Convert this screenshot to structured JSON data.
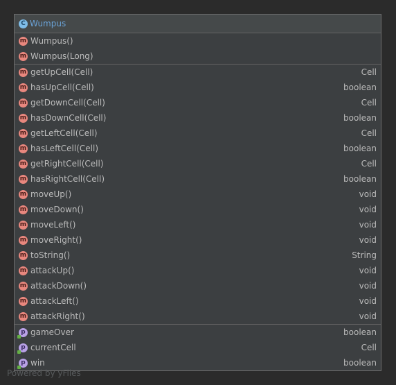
{
  "class": {
    "name": "Wumpus",
    "icon": "class-icon",
    "icon_letter": "C"
  },
  "constructors": [
    {
      "name": "Wumpus()",
      "type": ""
    },
    {
      "name": "Wumpus(Long)",
      "type": ""
    }
  ],
  "methods": [
    {
      "name": "getUpCell(Cell)",
      "type": "Cell"
    },
    {
      "name": "hasUpCell(Cell)",
      "type": "boolean"
    },
    {
      "name": "getDownCell(Cell)",
      "type": "Cell"
    },
    {
      "name": "hasDownCell(Cell)",
      "type": "boolean"
    },
    {
      "name": "getLeftCell(Cell)",
      "type": "Cell"
    },
    {
      "name": "hasLeftCell(Cell)",
      "type": "boolean"
    },
    {
      "name": "getRightCell(Cell)",
      "type": "Cell"
    },
    {
      "name": "hasRightCell(Cell)",
      "type": "boolean"
    },
    {
      "name": "moveUp()",
      "type": "void"
    },
    {
      "name": "moveDown()",
      "type": "void"
    },
    {
      "name": "moveLeft()",
      "type": "void"
    },
    {
      "name": "moveRight()",
      "type": "void"
    },
    {
      "name": "toString()",
      "type": "String"
    },
    {
      "name": "attackUp()",
      "type": "void"
    },
    {
      "name": "attackDown()",
      "type": "void"
    },
    {
      "name": "attackLeft()",
      "type": "void"
    },
    {
      "name": "attackRight()",
      "type": "void"
    }
  ],
  "properties": [
    {
      "name": "gameOver",
      "type": "boolean"
    },
    {
      "name": "currentCell",
      "type": "Cell"
    },
    {
      "name": "win",
      "type": "boolean"
    }
  ],
  "icon_letters": {
    "method": "m",
    "property": "p"
  },
  "watermark": "Powered by yFiles",
  "colors": {
    "background": "#2b2b2b",
    "class_name": "#6aa2d6",
    "method_icon": "#e8877e",
    "property_icon": "#b9a1e6",
    "class_icon": "#7fbde8",
    "text": "#bbbbbb"
  }
}
